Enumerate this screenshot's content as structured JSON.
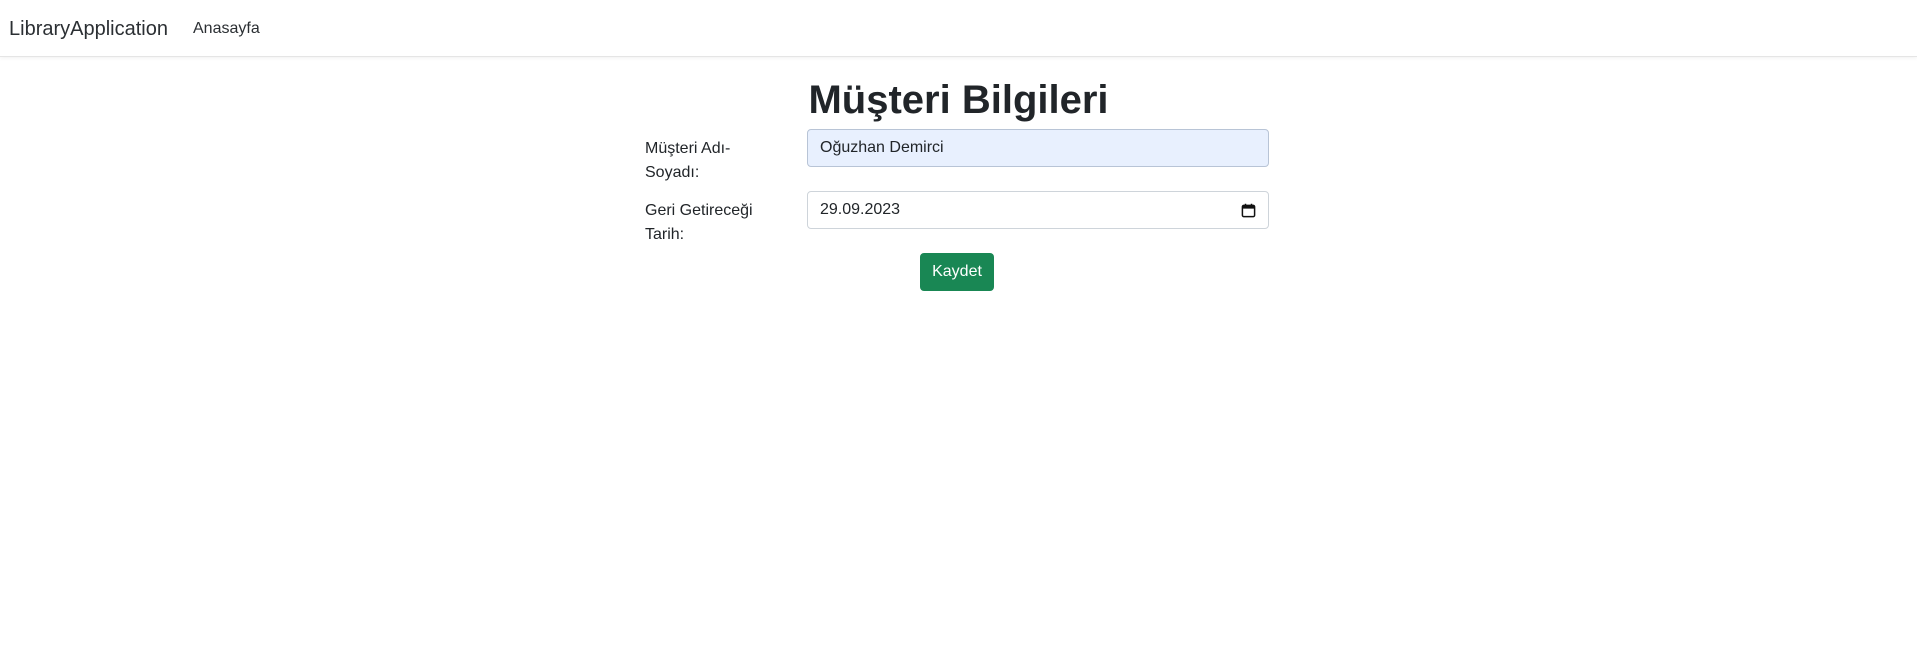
{
  "navbar": {
    "brand": "LibraryApplication",
    "links": [
      {
        "label": "Anasayfa"
      }
    ]
  },
  "page": {
    "title": "Müşteri Bilgileri"
  },
  "form": {
    "customer_name": {
      "label": "Müşteri Adı-Soyadı:",
      "value": "Oğuzhan Demirci"
    },
    "return_date": {
      "label": "Geri Getireceği Tarih:",
      "value": "29.09.2023",
      "icon": "calendar-icon"
    },
    "submit_label": "Kaydet"
  },
  "colors": {
    "primary_button": "#198754",
    "autofill_background": "#e8f0fe",
    "text": "#212529"
  }
}
